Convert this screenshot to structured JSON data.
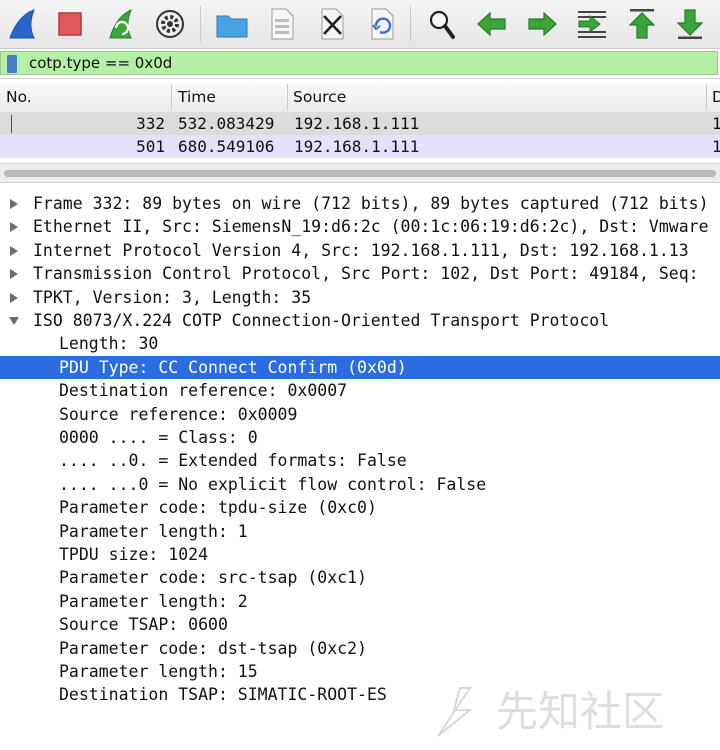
{
  "toolbar": {
    "buttons": [
      {
        "name": "start-capture-icon",
        "color": "#2a66c9"
      },
      {
        "name": "stop-capture-icon",
        "color": "#e05a5a"
      },
      {
        "name": "restart-capture-icon",
        "color": "#3aa53a"
      },
      {
        "name": "capture-options-icon",
        "color": "#333333"
      },
      {
        "name": "open-file-icon",
        "color": "#4aa3e0"
      },
      {
        "name": "save-file-icon",
        "color": "#bcbcbc"
      },
      {
        "name": "close-file-icon",
        "color": "#222222"
      },
      {
        "name": "reload-file-icon",
        "color": "#3a6fd0"
      },
      {
        "name": "find-packet-icon",
        "color": "#222222"
      },
      {
        "name": "go-back-icon",
        "color": "#3aa53a"
      },
      {
        "name": "go-forward-icon",
        "color": "#3aa53a"
      },
      {
        "name": "go-to-packet-icon",
        "color": "#3aa53a"
      },
      {
        "name": "go-first-icon",
        "color": "#3aa53a"
      },
      {
        "name": "go-last-icon",
        "color": "#3aa53a"
      }
    ]
  },
  "filter": {
    "value": "cotp.type == 0x0d",
    "valid_color": "#b6f0a6"
  },
  "packet_list": {
    "columns": [
      "No.",
      "Time",
      "Source",
      "D"
    ],
    "rows": [
      {
        "no": "332",
        "time": "532.083429",
        "source": "192.168.1.111",
        "dest": "1"
      },
      {
        "no": "501",
        "time": "680.549106",
        "source": "192.168.1.111",
        "dest": "1"
      }
    ]
  },
  "details": {
    "items": [
      {
        "text": "Frame 332: 89 bytes on wire (712 bits), 89 bytes captured (712 bits)",
        "expanded": false
      },
      {
        "text": "Ethernet II, Src: SiemensN_19:d6:2c (00:1c:06:19:d6:2c), Dst: Vmware",
        "expanded": false
      },
      {
        "text": "Internet Protocol Version 4, Src: 192.168.1.111, Dst: 192.168.1.13",
        "expanded": false
      },
      {
        "text": "Transmission Control Protocol, Src Port: 102, Dst Port: 49184, Seq:",
        "expanded": false
      },
      {
        "text": "TPKT, Version: 3, Length: 35",
        "expanded": false
      },
      {
        "text": "ISO 8073/X.224 COTP Connection-Oriented Transport Protocol",
        "expanded": true
      },
      {
        "text": "Length: 30"
      },
      {
        "text": "PDU Type: CC Connect Confirm (0x0d)",
        "selected": true
      },
      {
        "text": "Destination reference: 0x0007"
      },
      {
        "text": "Source reference: 0x0009"
      },
      {
        "text": "0000 .... = Class: 0"
      },
      {
        "text": ".... ..0. = Extended formats: False"
      },
      {
        "text": ".... ...0 = No explicit flow control: False"
      },
      {
        "text": "Parameter code: tpdu-size (0xc0)"
      },
      {
        "text": "Parameter length: 1"
      },
      {
        "text": "TPDU size: 1024"
      },
      {
        "text": "Parameter code: src-tsap (0xc1)"
      },
      {
        "text": "Parameter length: 2"
      },
      {
        "text": "Source TSAP: 0600"
      },
      {
        "text": "Parameter code: dst-tsap (0xc2)"
      },
      {
        "text": "Parameter length: 15"
      },
      {
        "text": "Destination TSAP: SIMATIC-ROOT-ES"
      }
    ],
    "selection_color": "#2b6de0"
  },
  "watermark": {
    "text": "先知社区"
  }
}
